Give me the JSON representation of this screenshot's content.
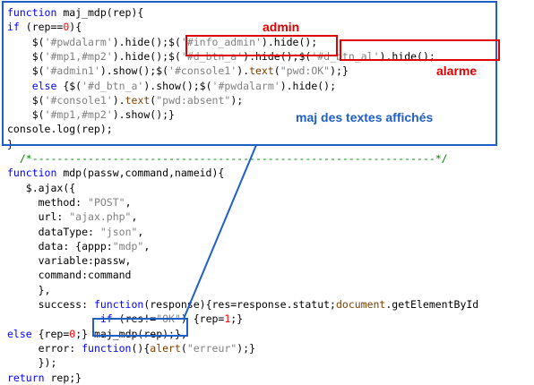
{
  "code_lines": [
    {
      "indent": "",
      "parts": [
        {
          "t": "function ",
          "c": "kw"
        },
        {
          "t": "maj_mdp(rep){",
          "c": "plain"
        }
      ]
    },
    {
      "indent": "",
      "parts": [
        {
          "t": "if ",
          "c": "kw"
        },
        {
          "t": "(rep==",
          "c": "plain"
        },
        {
          "t": "0",
          "c": "num"
        },
        {
          "t": "){",
          "c": "plain"
        }
      ]
    },
    {
      "indent": "    ",
      "parts": [
        {
          "t": "$(",
          "c": "plain"
        },
        {
          "t": "'#pwdalarm'",
          "c": "str"
        },
        {
          "t": ").hide();$(",
          "c": "plain"
        },
        {
          "t": "'#info_admin'",
          "c": "str"
        },
        {
          "t": ").hide();",
          "c": "plain"
        }
      ]
    },
    {
      "indent": "    ",
      "parts": [
        {
          "t": "$(",
          "c": "plain"
        },
        {
          "t": "'#mp1,#mp2'",
          "c": "str"
        },
        {
          "t": ").hide();",
          "c": "plain"
        },
        {
          "t": "$(",
          "c": "plain"
        },
        {
          "t": "'#d_btn_a'",
          "c": "str"
        },
        {
          "t": ").hide();",
          "c": "plain"
        },
        {
          "t": "$(",
          "c": "plain"
        },
        {
          "t": "'#d_btn_al'",
          "c": "str"
        },
        {
          "t": ").hide();",
          "c": "plain"
        }
      ]
    },
    {
      "indent": "    ",
      "parts": [
        {
          "t": "$(",
          "c": "plain"
        },
        {
          "t": "'#admin1'",
          "c": "str"
        },
        {
          "t": ").show();$(",
          "c": "plain"
        },
        {
          "t": "'#console1'",
          "c": "str"
        },
        {
          "t": ").",
          "c": "plain"
        },
        {
          "t": "text",
          "c": "fn"
        },
        {
          "t": "(",
          "c": "plain"
        },
        {
          "t": "\"pwd:OK\"",
          "c": "str"
        },
        {
          "t": ");}",
          "c": "plain"
        }
      ]
    },
    {
      "indent": "    ",
      "parts": [
        {
          "t": "else ",
          "c": "kw"
        },
        {
          "t": "{$(",
          "c": "plain"
        },
        {
          "t": "'#d_btn_a'",
          "c": "str"
        },
        {
          "t": ").show();$(",
          "c": "plain"
        },
        {
          "t": "'#pwdalarm'",
          "c": "str"
        },
        {
          "t": ").hide();",
          "c": "plain"
        }
      ]
    },
    {
      "indent": "    ",
      "parts": [
        {
          "t": "$(",
          "c": "plain"
        },
        {
          "t": "'#console1'",
          "c": "str"
        },
        {
          "t": ").",
          "c": "plain"
        },
        {
          "t": "text",
          "c": "fn"
        },
        {
          "t": "(",
          "c": "plain"
        },
        {
          "t": "\"pwd:absent\"",
          "c": "str"
        },
        {
          "t": ");",
          "c": "plain"
        }
      ]
    },
    {
      "indent": "    ",
      "parts": [
        {
          "t": "$(",
          "c": "plain"
        },
        {
          "t": "'#mp1,#mp2'",
          "c": "str"
        },
        {
          "t": ").show();}",
          "c": "plain"
        }
      ]
    },
    {
      "indent": "",
      "parts": [
        {
          "t": "console.log(rep);",
          "c": "plain"
        }
      ]
    },
    {
      "indent": "",
      "parts": [
        {
          "t": "}",
          "c": "plain"
        }
      ]
    },
    {
      "indent": "  ",
      "parts": [
        {
          "t": "/*-----------------------------------------------------------------*/",
          "c": "cmt"
        }
      ]
    },
    {
      "indent": "",
      "parts": [
        {
          "t": "function ",
          "c": "kw"
        },
        {
          "t": "mdp(passw,command,nameid){",
          "c": "plain"
        }
      ]
    },
    {
      "indent": "   ",
      "parts": [
        {
          "t": "$.ajax({",
          "c": "plain"
        }
      ]
    },
    {
      "indent": "     ",
      "parts": [
        {
          "t": "method: ",
          "c": "plain"
        },
        {
          "t": "\"POST\"",
          "c": "str"
        },
        {
          "t": ",",
          "c": "plain"
        }
      ]
    },
    {
      "indent": "     ",
      "parts": [
        {
          "t": "url: ",
          "c": "plain"
        },
        {
          "t": "\"ajax.php\"",
          "c": "str"
        },
        {
          "t": ",",
          "c": "plain"
        }
      ]
    },
    {
      "indent": "     ",
      "parts": [
        {
          "t": "dataType: ",
          "c": "plain"
        },
        {
          "t": "\"json\"",
          "c": "str"
        },
        {
          "t": ",",
          "c": "plain"
        }
      ]
    },
    {
      "indent": "     ",
      "parts": [
        {
          "t": "data: {appp:",
          "c": "plain"
        },
        {
          "t": "\"mdp\"",
          "c": "str"
        },
        {
          "t": ",",
          "c": "plain"
        }
      ]
    },
    {
      "indent": "     ",
      "parts": [
        {
          "t": "variable:passw,",
          "c": "plain"
        }
      ]
    },
    {
      "indent": "     ",
      "parts": [
        {
          "t": "command:command",
          "c": "plain"
        }
      ]
    },
    {
      "indent": "     ",
      "parts": [
        {
          "t": "},",
          "c": "plain"
        }
      ]
    },
    {
      "indent": "     ",
      "parts": [
        {
          "t": "success: ",
          "c": "plain"
        },
        {
          "t": "function",
          "c": "kw"
        },
        {
          "t": "(response){res=response.statut;",
          "c": "plain"
        },
        {
          "t": "document",
          "c": "fn"
        },
        {
          "t": ".getElementById",
          "c": "plain"
        }
      ]
    },
    {
      "indent": "               ",
      "parts": [
        {
          "t": "if ",
          "c": "kw"
        },
        {
          "t": "(res!=",
          "c": "plain"
        },
        {
          "t": "\"OK\"",
          "c": "str"
        },
        {
          "t": ") {rep=",
          "c": "plain"
        },
        {
          "t": "1",
          "c": "num"
        },
        {
          "t": ";}",
          "c": "plain"
        }
      ]
    },
    {
      "indent": "",
      "parts": [
        {
          "t": "else ",
          "c": "kw"
        },
        {
          "t": "{rep=",
          "c": "plain"
        },
        {
          "t": "0",
          "c": "num"
        },
        {
          "t": ";} ",
          "c": "plain"
        },
        {
          "t": "maj_mdp(rep);",
          "c": "plain"
        },
        {
          "t": "},",
          "c": "plain"
        }
      ]
    },
    {
      "indent": "     ",
      "parts": [
        {
          "t": "error: ",
          "c": "plain"
        },
        {
          "t": "function",
          "c": "kw"
        },
        {
          "t": "(){",
          "c": "plain"
        },
        {
          "t": "alert",
          "c": "fn"
        },
        {
          "t": "(",
          "c": "plain"
        },
        {
          "t": "\"erreur\"",
          "c": "str"
        },
        {
          "t": ");}",
          "c": "plain"
        }
      ]
    },
    {
      "indent": "     ",
      "parts": [
        {
          "t": "});",
          "c": "plain"
        }
      ]
    },
    {
      "indent": "",
      "parts": [
        {
          "t": "return ",
          "c": "kw"
        },
        {
          "t": "rep;}",
          "c": "plain"
        }
      ]
    }
  ],
  "annotations": {
    "admin_label": "admin",
    "alarme_label": "alarme",
    "maj_label": "maj des textes affichés"
  },
  "colors": {
    "annotation_red": "#e00000",
    "annotation_blue": "#1f5fc8",
    "keyword": "#0000ff",
    "string": "#808080",
    "number": "#ff0000",
    "comment": "#008000"
  }
}
